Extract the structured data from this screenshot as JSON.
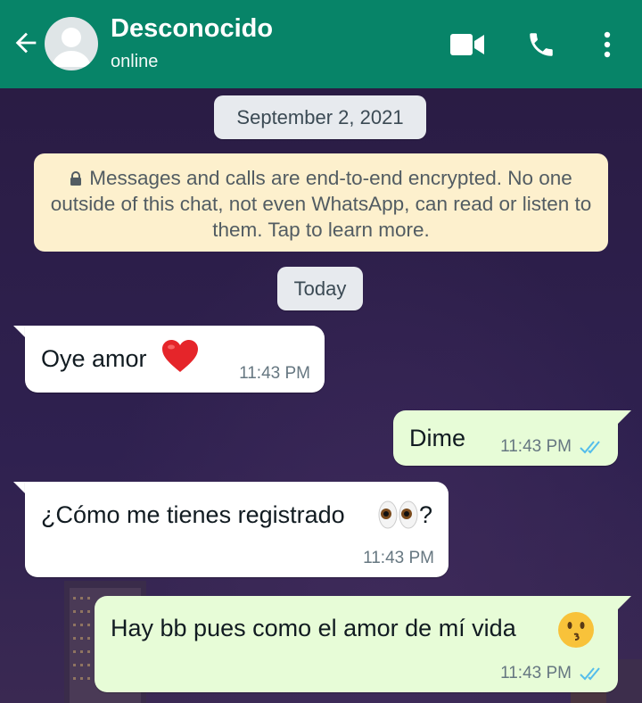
{
  "header": {
    "contact_name": "Desconocido",
    "status": "online"
  },
  "chips": {
    "date": "September 2, 2021",
    "today": "Today"
  },
  "encryption_notice": "Messages and calls are end-to-end encrypted. No one outside of this chat, not even WhatsApp, can read or listen to them. Tap to learn more.",
  "messages": [
    {
      "direction": "incoming",
      "text": "Oye amor",
      "emoji": "red-heart",
      "time": "11:43 PM"
    },
    {
      "direction": "outgoing",
      "text": "Dime",
      "time": "11:43 PM",
      "read": true
    },
    {
      "direction": "incoming",
      "text": "¿Cómo me tienes registrado",
      "emoji_after": "eyes",
      "text_end": "?",
      "time": "11:43 PM"
    },
    {
      "direction": "outgoing",
      "text": "Hay bb pues como el amor de mí vida",
      "emoji": "kissing-face",
      "time": "11:43 PM",
      "read": true
    }
  ],
  "colors": {
    "header": "#078468",
    "incoming_bubble": "#ffffff",
    "outgoing_bubble": "#e7fcd7",
    "read_ticks": "#53bdeb",
    "encryption_bg": "#fdf0cd"
  }
}
